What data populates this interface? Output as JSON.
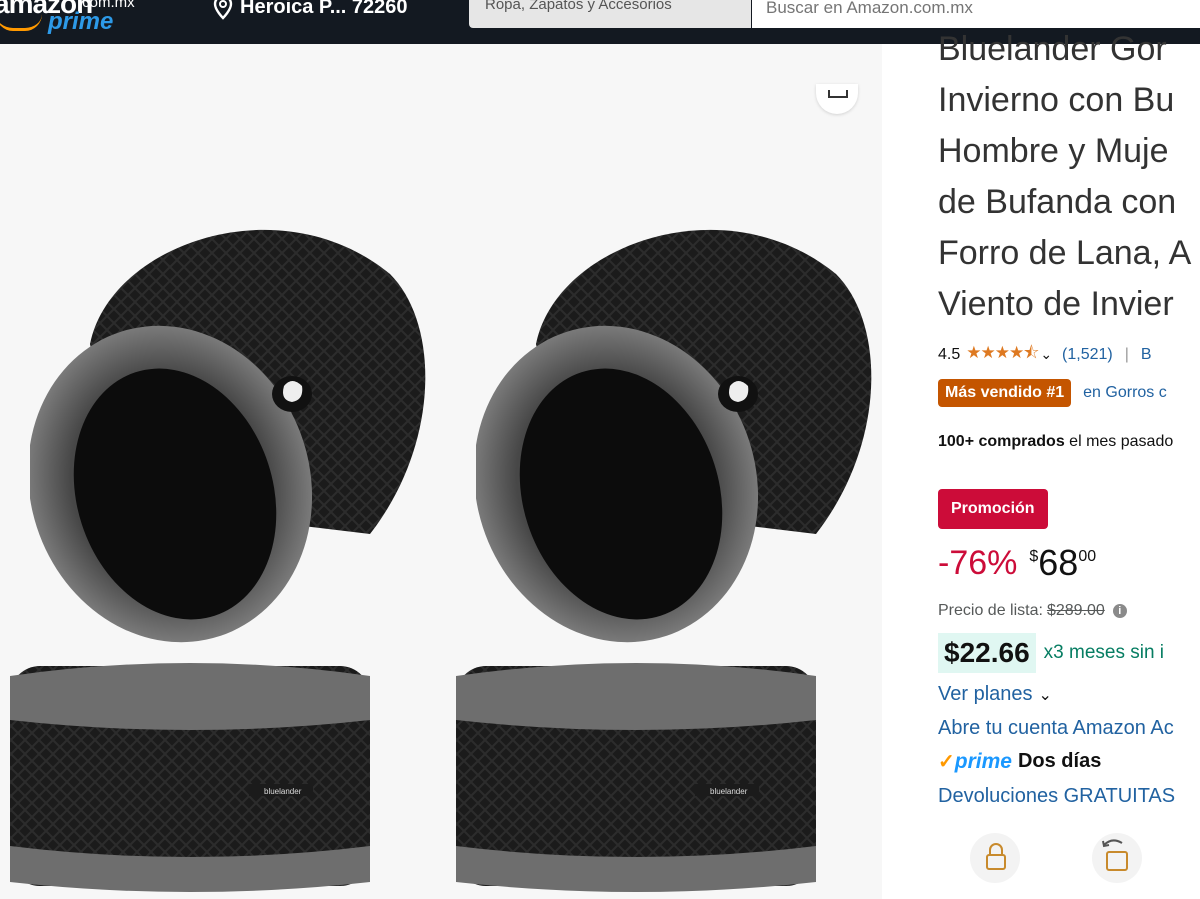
{
  "header": {
    "logo_main": "amazon",
    "logo_domain": ".com.mx",
    "logo_prime": "prime",
    "location": "Heroica P... 72260",
    "search_category": "Ropa, Zapatos y Accesorios",
    "search_placeholder": "Buscar en Amazon.com.mx"
  },
  "product": {
    "title_lines": [
      "Bluelander Gor",
      "Invierno con Bu",
      "Hombre y Muje",
      "de Bufanda con",
      "Forro de Lana, A",
      "Viento de Invier"
    ],
    "brand_label": "bluelander",
    "rating": "4.5",
    "stars": "★★★★⯪",
    "rating_count": "(1,521)",
    "rating_separator": "|",
    "rating_more": "B",
    "best_seller_badge": "Más vendido #1",
    "best_seller_category": "en Gorros c",
    "bought_bold": "100+ comprados",
    "bought_rest": " el mes pasado",
    "promo_label": "Promoción",
    "discount": "-76%",
    "currency": "$",
    "price_whole": "68",
    "price_cents": "00",
    "list_price_label": "Precio de lista:",
    "list_price": "$289.00",
    "installment_amount": "$22.66",
    "installment_text": "x3 meses sin i",
    "plans_link": "Ver planes",
    "open_account": "Abre tu cuenta Amazon Ac",
    "prime_word": "prime",
    "prime_days": "Dos días",
    "returns": "Devoluciones GRATUITAS"
  },
  "icons": {
    "location": "location-pin-icon",
    "share": "share-icon",
    "secure": "secure-transaction-icon",
    "returns": "returns-icon"
  },
  "colors": {
    "header_bg": "#131921",
    "prime_blue": "#1a98ff",
    "deal_red": "#cc0c39",
    "best_seller": "#c45500",
    "link": "#2162a1",
    "installment_green": "#067d62"
  }
}
